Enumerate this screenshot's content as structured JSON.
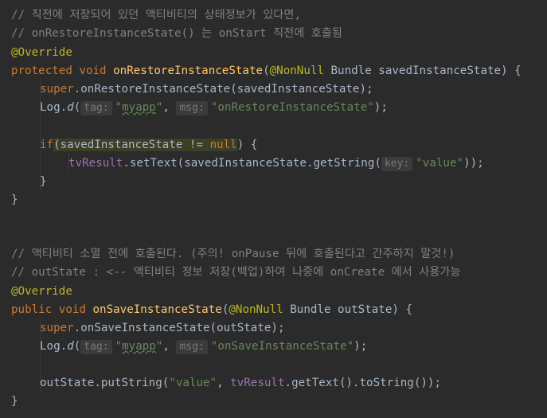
{
  "code": {
    "c1": "// 직전에 저장되어 있던 액티비티의 상태정보가 있다면,",
    "c2": "// onRestoreInstanceState() 는 onStart 직전에 호출됨",
    "override": "@Override",
    "protected_kw": "protected",
    "void_kw": "void",
    "restore_fn": "onRestoreInstanceState",
    "nonnull": "@NonNull",
    "restore_params": " Bundle savedInstanceState) {",
    "super_kw": "super",
    "super_restore_call": ".onRestoreInstanceState(savedInstanceState);",
    "log": "Log.",
    "log_d": "d",
    "tag_hint": "tag:",
    "myapp_str": "\"myapp\"",
    "comma": ", ",
    "msg_hint": "msg:",
    "restore_msg_str": "\"onRestoreInstanceState\"",
    "close_paren_semicolon": ");",
    "if_kw": "if",
    "if_cond_open": "(",
    "if_var": "savedInstanceState != ",
    "null_kw": "null",
    "if_close": ") {",
    "tvresult": "tvResult",
    "settext_call": ".setText(savedInstanceState.getString(",
    "key_hint": "key:",
    "value_str": "\"value\"",
    "close_double": "));",
    "close_brace": "}",
    "c3": "// 액티비티 소멸 전에 호출된다. (주의! onPause 뒤에 호출된다고 간주하지 말것!)",
    "c4": "// outState : <-- 액티비티 정보 저장(백업)하여 나중에 onCreate 에서 사용가능",
    "public_kw": "public",
    "save_fn": "onSaveInstanceState",
    "save_params": " Bundle outState) {",
    "super_save_call": ".onSaveInstanceState(outState);",
    "save_msg_str": "\"onSaveInstanceState\"",
    "putstring_open": "outState.putString(",
    "tvresult_call": ".getText().toString());"
  },
  "colors": {
    "background": "#2b2b2b",
    "keyword": "#cc7832",
    "function": "#ffc66d",
    "annotation": "#bbb529",
    "string": "#6a8759",
    "comment": "#808080",
    "field": "#9876aa",
    "default_text": "#a9b7c6"
  }
}
